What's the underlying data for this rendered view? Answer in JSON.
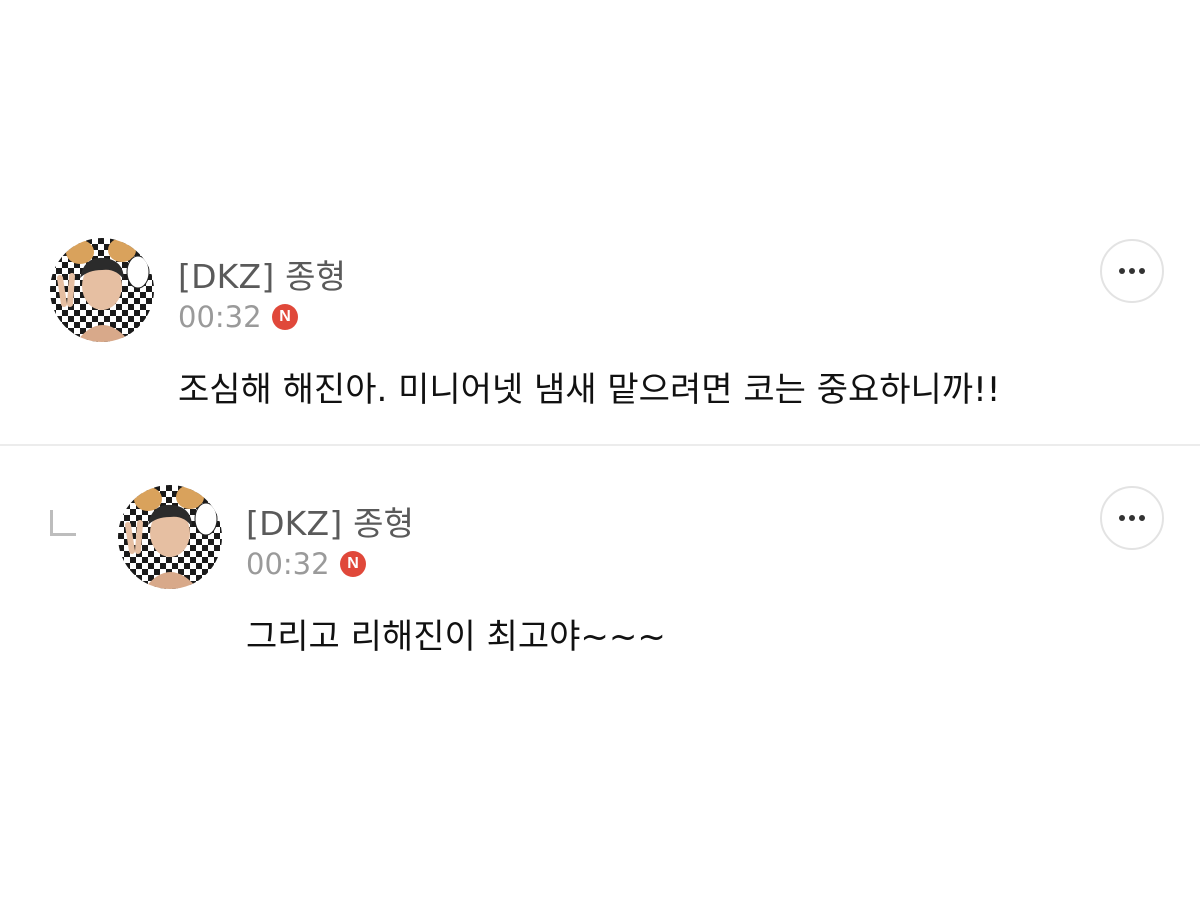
{
  "comments": [
    {
      "author": "[DKZ] 종형",
      "time": "00:32",
      "badge": "N",
      "text": "조심해 해진아. 미니어넷 냄새 맡으려면 코는 중요하니까!!",
      "avatar_icon": "profile-photo"
    },
    {
      "author": "[DKZ] 종형",
      "time": "00:32",
      "badge": "N",
      "text": "그리고 리해진이 최고야~~~",
      "avatar_icon": "profile-photo",
      "is_reply": true
    }
  ],
  "icons": {
    "more": "more-dots-icon",
    "reply": "reply-arrow-icon"
  },
  "colors": {
    "badge": "#e0483a",
    "author": "#5a5a5a",
    "time": "#9a9a9a",
    "divider": "#ececec"
  }
}
